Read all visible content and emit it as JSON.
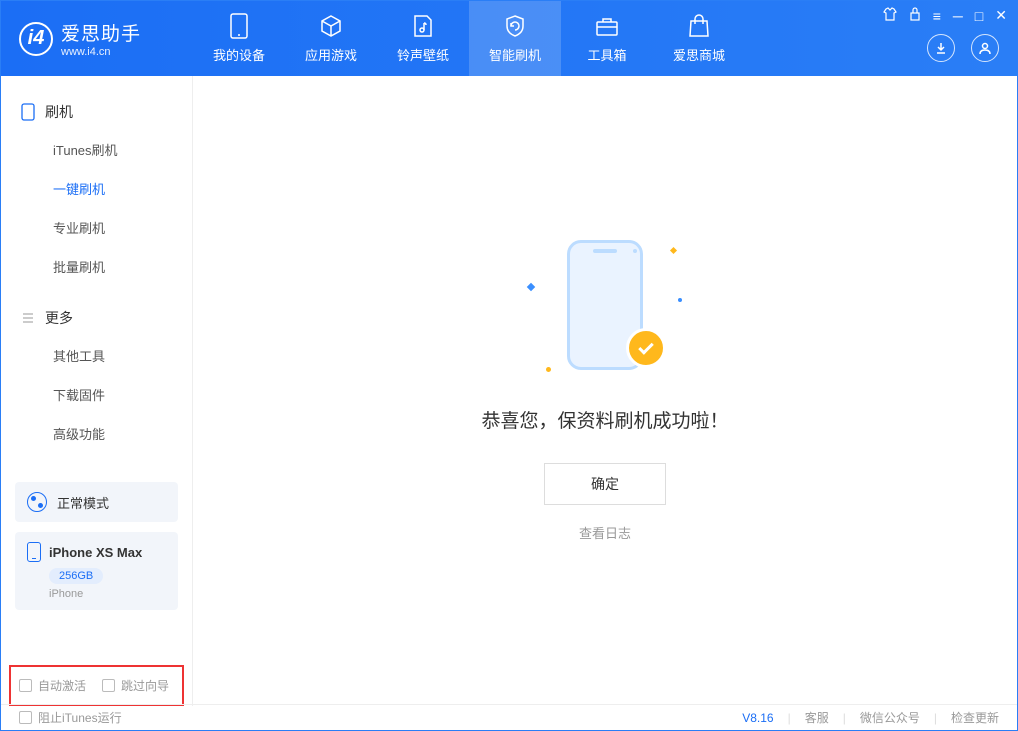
{
  "app": {
    "name": "爱思助手",
    "url": "www.i4.cn"
  },
  "nav": {
    "tabs": [
      {
        "label": "我的设备"
      },
      {
        "label": "应用游戏"
      },
      {
        "label": "铃声壁纸"
      },
      {
        "label": "智能刷机"
      },
      {
        "label": "工具箱"
      },
      {
        "label": "爱思商城"
      }
    ]
  },
  "sidebar": {
    "group1": {
      "title": "刷机",
      "items": [
        "iTunes刷机",
        "一键刷机",
        "专业刷机",
        "批量刷机"
      ]
    },
    "group2": {
      "title": "更多",
      "items": [
        "其他工具",
        "下载固件",
        "高级功能"
      ]
    }
  },
  "mode": {
    "label": "正常模式"
  },
  "device": {
    "name": "iPhone XS Max",
    "storage": "256GB",
    "type": "iPhone"
  },
  "options": {
    "auto_activate": "自动激活",
    "skip_guide": "跳过向导"
  },
  "main": {
    "success_text": "恭喜您，保资料刷机成功啦！",
    "ok": "确定",
    "view_log": "查看日志"
  },
  "status": {
    "block_itunes": "阻止iTunes运行",
    "version": "V8.16",
    "support": "客服",
    "wechat": "微信公众号",
    "update": "检查更新"
  }
}
